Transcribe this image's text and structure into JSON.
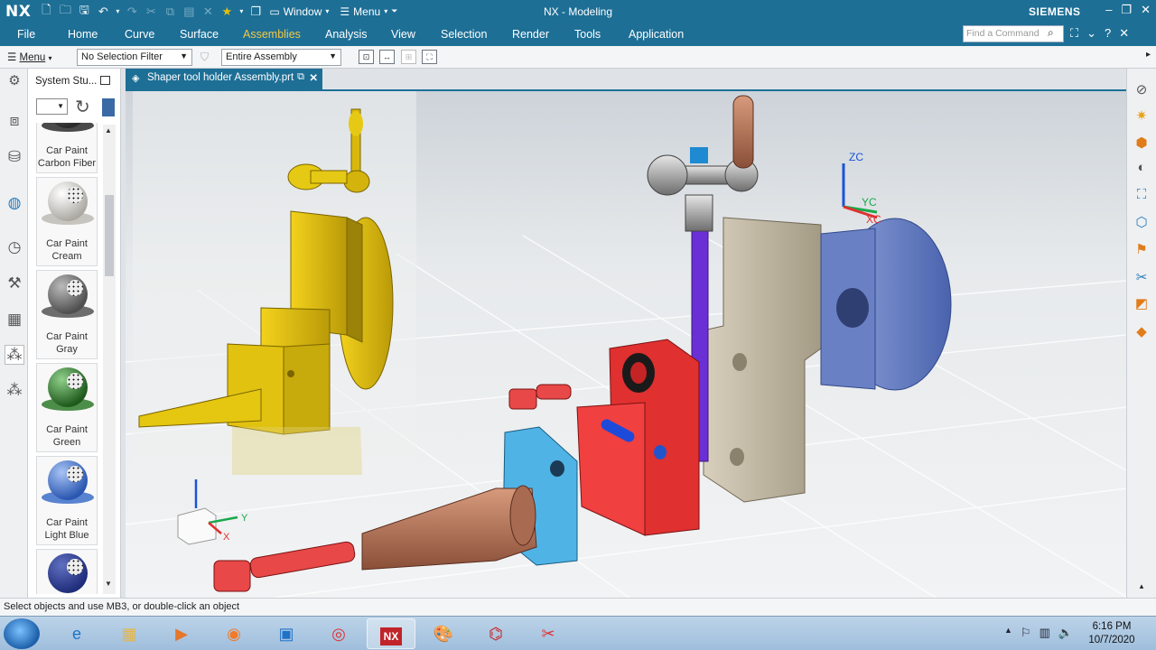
{
  "titlebar": {
    "logo": "NX",
    "window_menu": "Window",
    "menu_label": "Menu",
    "title": "NX - Modeling",
    "brand": "SIEMENS"
  },
  "ribbon": {
    "tabs": [
      "File",
      "Home",
      "Curve",
      "Surface",
      "Assemblies",
      "Analysis",
      "View",
      "Selection",
      "Render",
      "Tools",
      "Application"
    ],
    "active_tab": "Assemblies",
    "command_finder_placeholder": "Find a Command"
  },
  "selection_bar": {
    "menu_label": "Menu",
    "filter_value": "No Selection Filter",
    "scope_value": "Entire Assembly"
  },
  "material_panel": {
    "title": "System Stu...",
    "items": [
      {
        "label_line1": "Car Paint",
        "label_line2": "Carbon Fiber",
        "color": "#2b2b2b"
      },
      {
        "label_line1": "Car Paint",
        "label_line2": "Cream",
        "color": "#d9d7cf"
      },
      {
        "label_line1": "Car Paint",
        "label_line2": "Gray",
        "color": "#6d6d6d"
      },
      {
        "label_line1": "Car Paint",
        "label_line2": "Green",
        "color": "#2f7a2c"
      },
      {
        "label_line1": "Car Paint",
        "label_line2": "Light Blue",
        "color": "#3c6ec9"
      },
      {
        "label_line1": "",
        "label_line2": "",
        "color": "#1f2d7a"
      }
    ]
  },
  "graphics": {
    "file_tab": "Shaper tool holder Assembly.prt",
    "csys_labels": {
      "zc": "ZC",
      "yc": "YC",
      "xc": "XC"
    },
    "triad_labels": {
      "y": "Y",
      "x": "X"
    }
  },
  "status": {
    "message": "Select objects and use MB3, or double-click an object"
  },
  "taskbar": {
    "nx_label": "NX",
    "time": "6:16 PM",
    "date": "10/7/2020"
  },
  "colors": {
    "accent": "#1d6f96",
    "active_tab": "#f6c842"
  }
}
